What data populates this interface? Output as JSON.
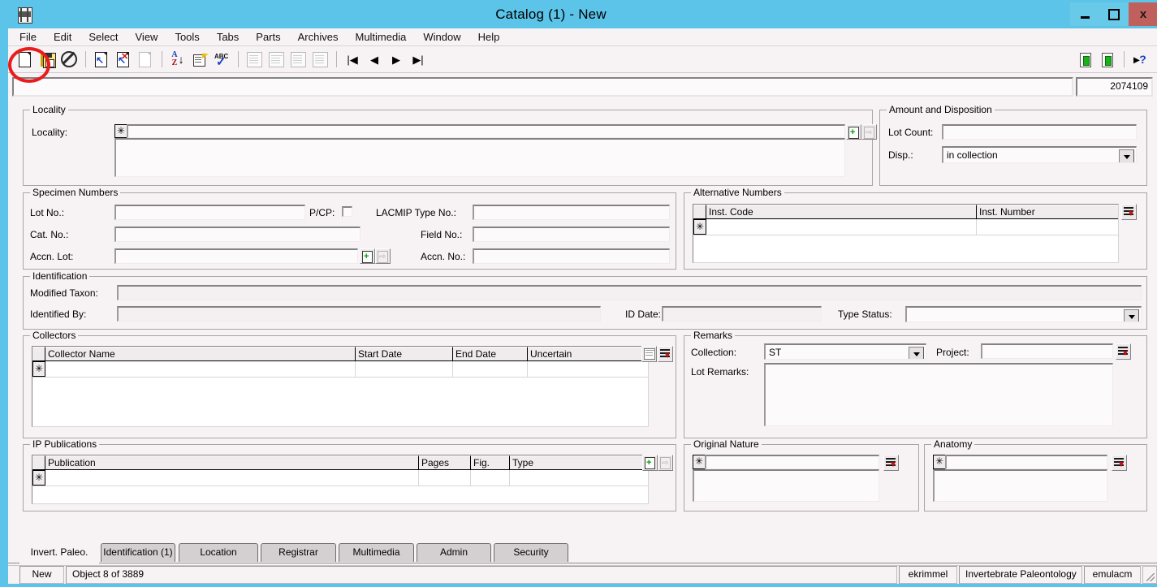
{
  "window": {
    "title": "Catalog (1) - New",
    "icon": "application-icon",
    "buttons": {
      "minimize": "–",
      "maximize": "□",
      "close": "x"
    },
    "colors": {
      "titlebar": "#5bc4e8",
      "close": "#c0605c",
      "client": "#f7f2f4",
      "accent_red": "#e81c1c"
    }
  },
  "menubar": {
    "items": [
      "File",
      "Edit",
      "Select",
      "View",
      "Tools",
      "Tabs",
      "Parts",
      "Archives",
      "Multimedia",
      "Window",
      "Help"
    ]
  },
  "toolbar": {
    "left_icons": [
      "new-document-icon",
      "save-icon",
      "cancel-icon",
      "insert-record-icon",
      "delete-record-icon",
      "duplicate-record-icon",
      "sort-icon",
      "edit-note-icon",
      "spellcheck-icon",
      "report-list-icon",
      "report-grid-icon",
      "report-card-icon",
      "report-image-icon",
      "first-record-icon",
      "previous-record-icon",
      "next-record-icon",
      "last-record-icon"
    ],
    "right_icons": [
      "attach-document-icon",
      "attach-document-2-icon",
      "help-cursor-icon"
    ]
  },
  "annotation": {
    "shape": "red-ellipse",
    "target": "new-document-icon"
  },
  "topbar": {
    "main_value": "",
    "record_id": "2074109"
  },
  "groups": {
    "locality": {
      "title": "Locality",
      "label": "Locality:",
      "value": "",
      "star": "✳",
      "buttons": [
        "add-locality-icon",
        "goto-locality-icon"
      ]
    },
    "amount_disposition": {
      "title": "Amount and Disposition",
      "lot_count_label": "Lot Count:",
      "lot_count_value": "",
      "disp_label": "Disp.:",
      "disp_value": "in collection"
    },
    "specimen_numbers": {
      "title": "Specimen Numbers",
      "lot_no_label": "Lot No.:",
      "lot_no_value": "",
      "pcp_label": "P/CP:",
      "pcp_checked": false,
      "cat_no_label": "Cat. No.:",
      "cat_no_value": "",
      "accn_lot_label": "Accn. Lot:",
      "accn_lot_value": "",
      "lacmip_label": "LACMIP Type No.:",
      "lacmip_value": "",
      "field_no_label": "Field No.:",
      "field_no_value": "",
      "accn_no_label": "Accn. No.:",
      "accn_no_value": ""
    },
    "alternative_numbers": {
      "title": "Alternative Numbers",
      "columns": [
        "Inst. Code",
        "Inst. Number"
      ],
      "rows": [
        {
          "marker": "✳",
          "cells": [
            "",
            ""
          ]
        }
      ],
      "side_button": "list-pin-icon"
    },
    "identification": {
      "title": "Identification",
      "modified_taxon_label": "Modified Taxon:",
      "modified_taxon_value": "",
      "identified_by_label": "Identified By:",
      "identified_by_value": "",
      "id_date_label": "ID Date:",
      "id_date_value": "",
      "type_status_label": "Type Status:",
      "type_status_value": ""
    },
    "collectors": {
      "title": "Collectors",
      "columns": [
        "Collector Name",
        "Start Date",
        "End Date",
        "Uncertain"
      ],
      "rows": [
        {
          "marker": "✳",
          "cells": [
            "",
            "",
            "",
            ""
          ]
        }
      ],
      "side_buttons": [
        "grid-view-icon",
        "list-pin-icon"
      ]
    },
    "remarks": {
      "title": "Remarks",
      "collection_label": "Collection:",
      "collection_value": "ST",
      "project_label": "Project:",
      "project_value": "",
      "lot_remarks_label": "Lot Remarks:",
      "lot_remarks_value": "",
      "side_button": "list-pin-icon"
    },
    "ip_publications": {
      "title": "IP Publications",
      "columns": [
        "Publication",
        "Pages",
        "Fig.",
        "Type"
      ],
      "rows": [
        {
          "marker": "✳",
          "cells": [
            "",
            "",
            "",
            ""
          ]
        }
      ],
      "side_buttons": [
        "add-publication-icon",
        "goto-publication-icon"
      ]
    },
    "original_nature": {
      "title": "Original Nature",
      "rows": [
        {
          "marker": "✳",
          "value": ""
        }
      ],
      "side_button": "list-pin-icon"
    },
    "anatomy": {
      "title": "Anatomy",
      "rows": [
        {
          "marker": "✳",
          "value": ""
        }
      ],
      "side_button": "list-pin-icon"
    }
  },
  "tabs": {
    "active": "Invert. Paleo.",
    "items": [
      "Invert. Paleo.",
      "Identification (1)",
      "Location",
      "Registrar",
      "Multimedia",
      "Admin",
      "Security"
    ]
  },
  "statusbar": {
    "mode": "New",
    "record_position": "Object 8 of 3889",
    "user": "ekrimmel",
    "department": "Invertebrate Paleontology",
    "database": "emulacm"
  }
}
